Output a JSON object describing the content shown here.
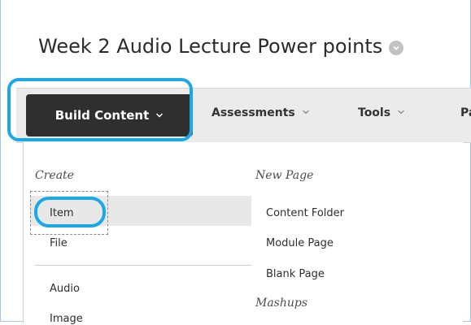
{
  "page": {
    "title": "Week 2 Audio Lecture Power points"
  },
  "toolbar": {
    "build_content": "Build Content",
    "assessments": "Assessments",
    "tools": "Tools",
    "partial": "Pa"
  },
  "menu": {
    "create_label": "Create",
    "create_items": [
      "Item",
      "File"
    ],
    "media_items": [
      "Audio",
      "Image"
    ],
    "new_page_label": "New Page",
    "new_page_items": [
      "Content Folder",
      "Module Page",
      "Blank Page"
    ],
    "mashups_label": "Mashups"
  },
  "colors": {
    "highlight": "#1ba8e6",
    "build_button_bg": "#2f2f2f",
    "toolbar_bg": "#ebebeb"
  },
  "icons": {
    "title_chevron": "chevron-down-circle-icon",
    "menu_chevron": "chevron-down-icon"
  }
}
